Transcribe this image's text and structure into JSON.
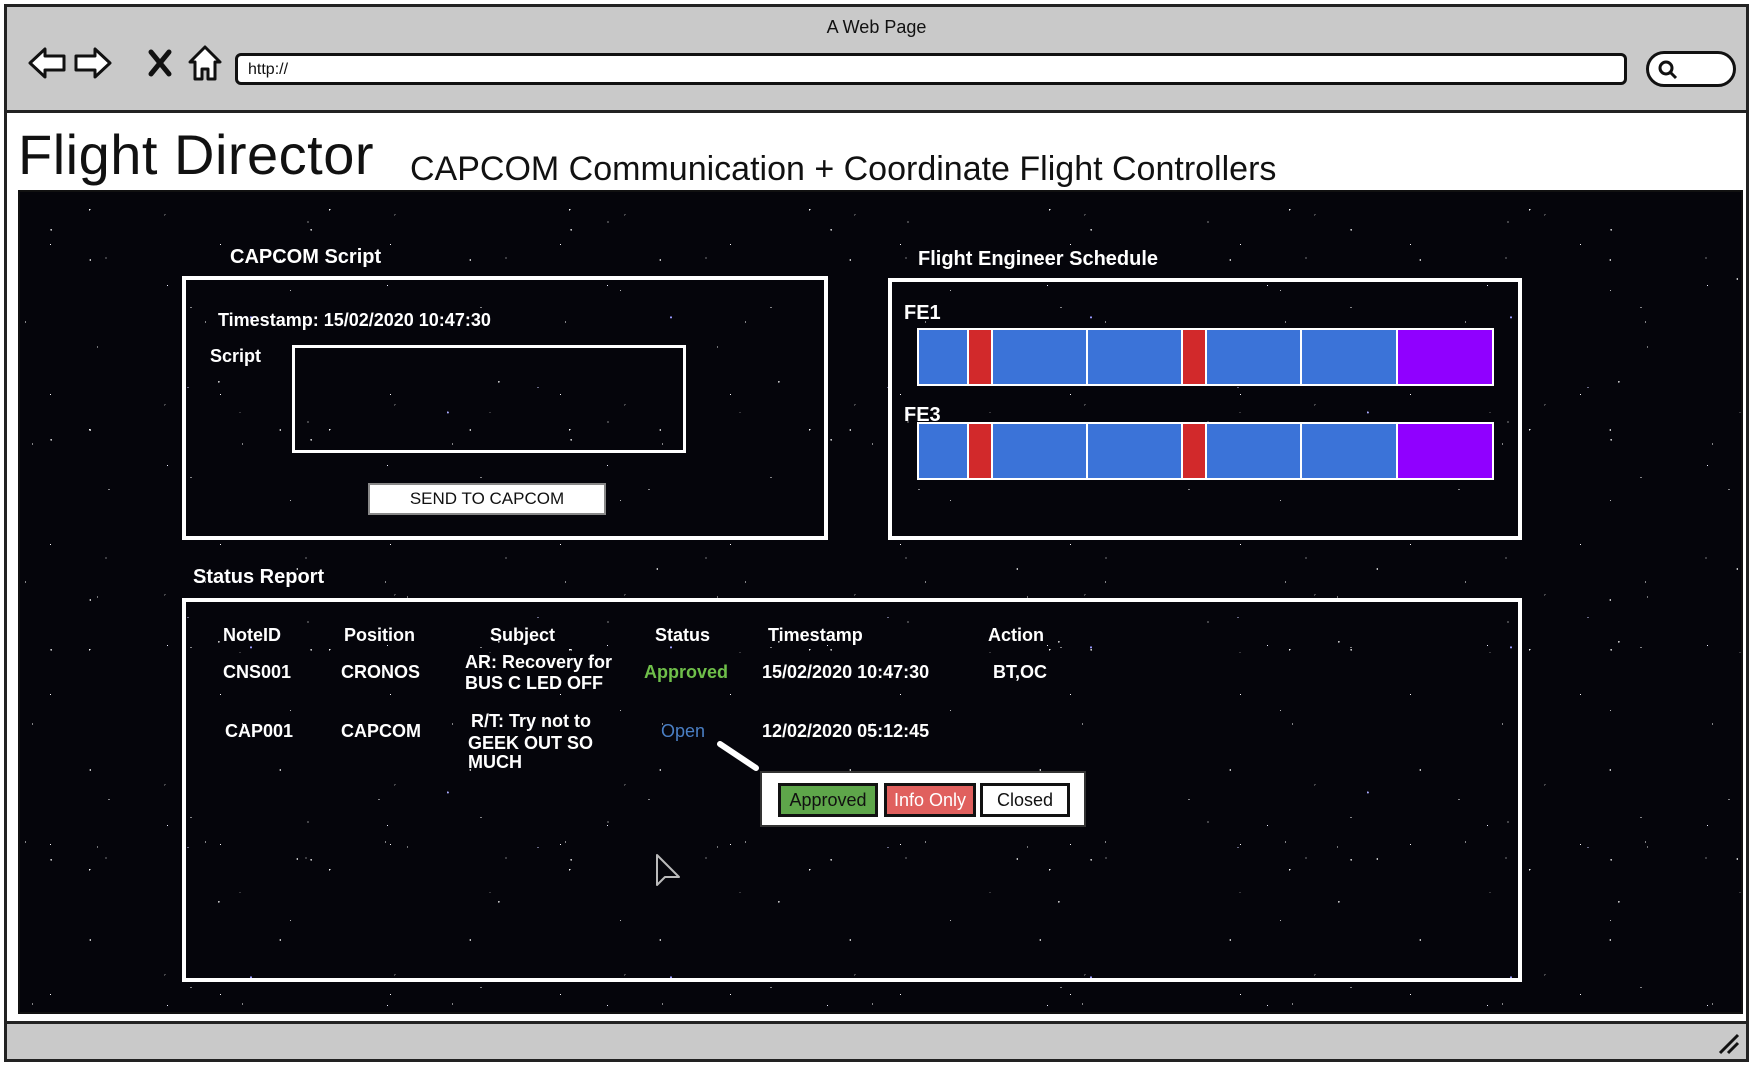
{
  "browser": {
    "window_title": "A Web Page",
    "url": "http://"
  },
  "page": {
    "title": "Flight Director",
    "subtitle": "CAPCOM Communication + Coordinate Flight Controllers"
  },
  "capcom_script": {
    "heading": "CAPCOM Script",
    "timestamp_text": "Timestamp: 15/02/2020 10:47:30",
    "script_label": "Script",
    "script_value": "",
    "send_button": "SEND TO CAPCOM"
  },
  "schedule": {
    "heading": "Flight Engineer Schedule",
    "colors": {
      "blue": "#3b73d8",
      "red": "#d2292b",
      "purple": "#9000ff"
    },
    "rows": [
      {
        "label": "FE1",
        "segments": [
          "blue",
          "red",
          "blue",
          "blue",
          "red",
          "blue",
          "blue",
          "purple"
        ]
      },
      {
        "label": "FE3",
        "segments": [
          "blue",
          "red",
          "blue",
          "blue",
          "red",
          "blue",
          "blue",
          "purple"
        ]
      }
    ]
  },
  "status_report": {
    "heading": "Status Report",
    "columns": [
      "NoteID",
      "Position",
      "Subject",
      "Status",
      "Timestamp",
      "Action"
    ],
    "rows": [
      {
        "note_id": "CNS001",
        "position": "CRONOS",
        "subject_line1": "AR: Recovery for",
        "subject_line2": "BUS C LED OFF",
        "subject_line3": "",
        "status": "Approved",
        "status_color": "#6fbf4a",
        "timestamp": "15/02/2020 10:47:30",
        "action": "BT,OC"
      },
      {
        "note_id": "CAP001",
        "position": "CAPCOM",
        "subject_line1": "R/T: Try not to",
        "subject_line2": "GEEK OUT SO",
        "subject_line3": "MUCH",
        "status": "Open",
        "status_color": "#4a7fc4",
        "timestamp": "12/02/2020 05:12:45",
        "action": ""
      }
    ],
    "status_popup": {
      "options": [
        {
          "label": "Approved",
          "bg": "#5ea64a",
          "fg": "#111111"
        },
        {
          "label": "Info Only",
          "bg": "#e0605e",
          "fg": "#ffffff"
        },
        {
          "label": "Closed",
          "bg": "#ffffff",
          "fg": "#111111"
        }
      ]
    }
  }
}
